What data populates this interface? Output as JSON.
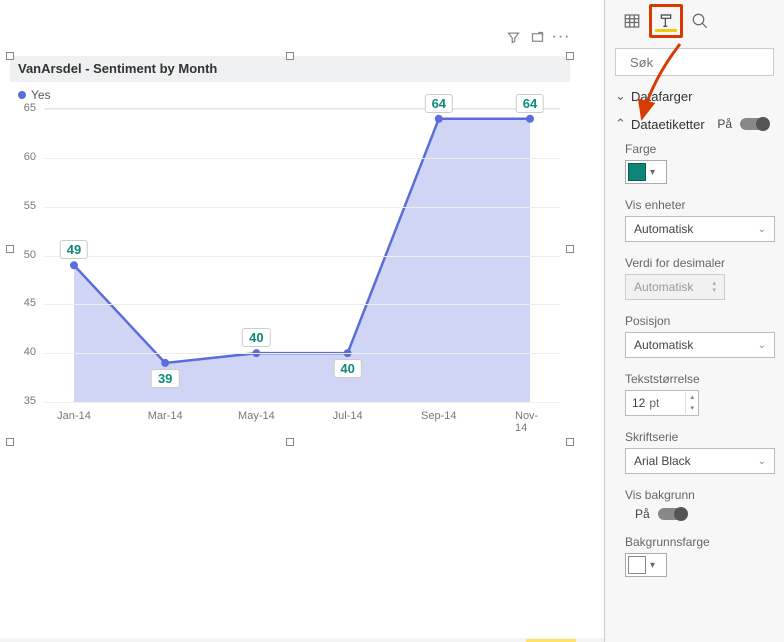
{
  "chart_data": {
    "type": "area",
    "title": "VanArsdel - Sentiment by Month",
    "legend": {
      "series_name": "Yes"
    },
    "categories": [
      "Jan-14",
      "Mar-14",
      "May-14",
      "Jul-14",
      "Sep-14",
      "Nov-14"
    ],
    "values": [
      49,
      39,
      40,
      40,
      64,
      64
    ],
    "label_positions": [
      "above",
      "below",
      "above",
      "below",
      "above",
      "above"
    ],
    "ylim": [
      35,
      65
    ],
    "y_ticks": [
      35,
      40,
      45,
      50,
      55,
      60,
      65
    ],
    "xlabel": "",
    "ylabel": "",
    "colors": {
      "line": "#5b6dd8",
      "fill": "rgba(120,135,225,0.35)",
      "label_text": "#0e8a7a"
    }
  },
  "pane": {
    "search_placeholder": "Søk",
    "section_colors": {
      "title": "Datafarger"
    },
    "section_labels": {
      "title": "Dataetiketter",
      "toggle_label": "På",
      "fields": {
        "color": {
          "label": "Farge"
        },
        "display_units": {
          "label": "Vis enheter",
          "value": "Automatisk"
        },
        "decimal_places": {
          "label": "Verdi for desimaler",
          "value": "Automatisk"
        },
        "position": {
          "label": "Posisjon",
          "value": "Automatisk"
        },
        "text_size": {
          "label": "Tekststørrelse",
          "value": "12",
          "unit": "pt"
        },
        "font_family": {
          "label": "Skriftserie",
          "value": "Arial Black"
        },
        "show_background": {
          "label": "Vis bakgrunn",
          "toggle_label": "På"
        },
        "background_color": {
          "label": "Bakgrunnsfarge"
        }
      }
    }
  }
}
